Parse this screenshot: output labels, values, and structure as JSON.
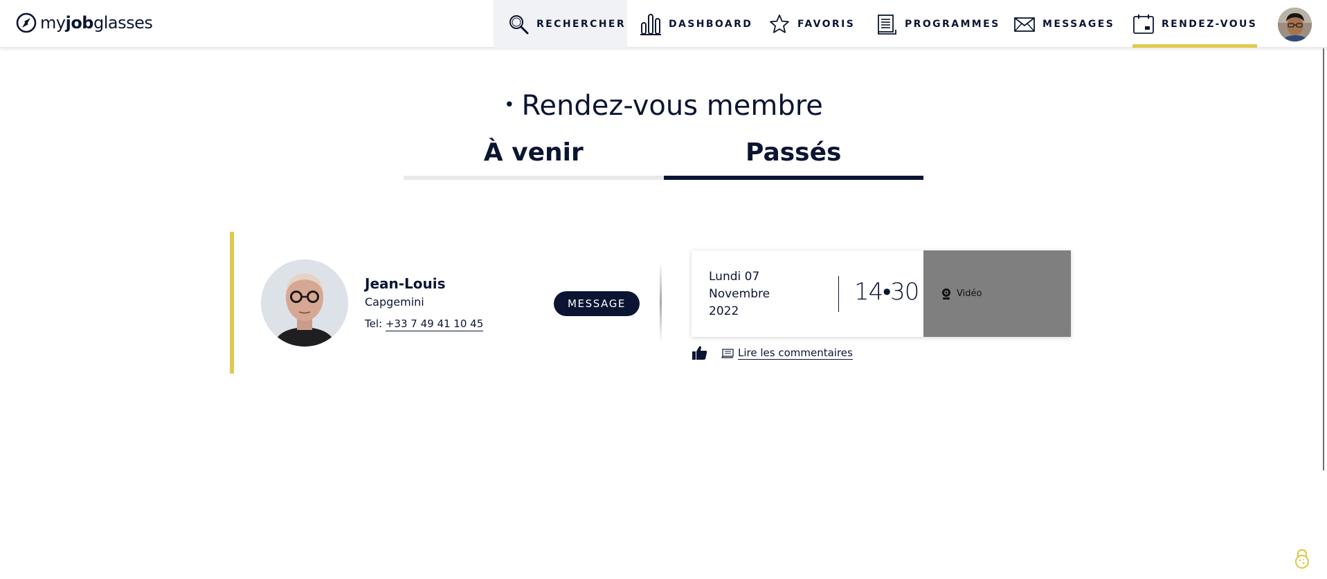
{
  "header": {
    "logo_light": "my",
    "logo_bold": "job",
    "logo_end": "glasses",
    "nav": {
      "search": "RECHERCHER",
      "dashboard": "DASHBOARD",
      "favoris": "FAVORIS",
      "programmes": "PROGRAMMES",
      "messages": "MESSAGES",
      "rdv": "RENDEZ-VOUS"
    },
    "active_item": "RENDEZ-VOUS"
  },
  "page": {
    "title": "Rendez-vous membre",
    "tabs": [
      "À venir",
      "Passés"
    ],
    "active_tab": "Passés"
  },
  "appointment": {
    "member_name": "Jean-Louis",
    "company": "Capgemini",
    "tel_label": "Tel:",
    "tel": "+33 7 49 41 10 45",
    "message_button": "MESSAGE",
    "date_line1": "Lundi 07",
    "date_line2": "Novembre",
    "date_line3": "2022",
    "time": "14•30",
    "mode": "Vidéo",
    "comments_link": "Lire les commentaires"
  },
  "colors": {
    "navy": "#0b1533",
    "accent_yellow": "#e1c94e",
    "video_panel": "#7f7f7f",
    "search_bg": "#f1f2f5"
  },
  "icons": [
    "logo-compass-icon",
    "search-icon",
    "bar-chart-icon",
    "star-icon",
    "document-list-icon",
    "envelope-icon",
    "calendar-icon",
    "webcam-icon",
    "thumbs-up-icon",
    "comment-icon",
    "cookie-lock-icon"
  ]
}
